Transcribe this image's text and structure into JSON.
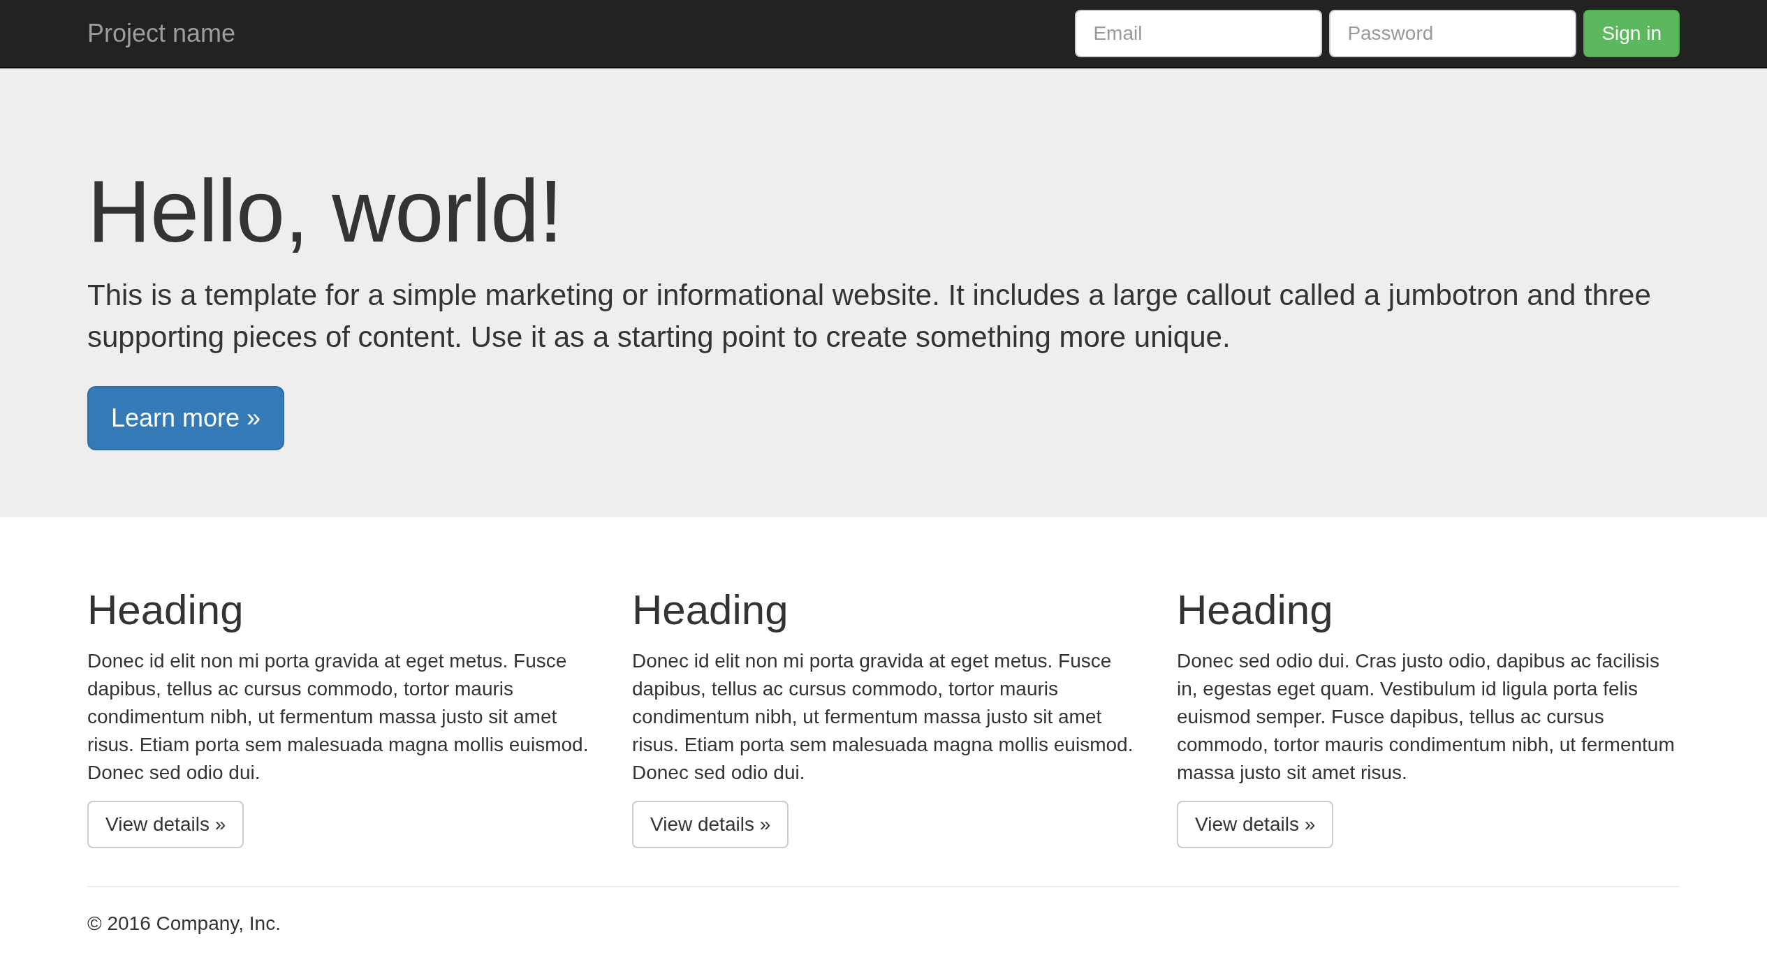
{
  "navbar": {
    "brand": "Project name",
    "email": {
      "placeholder": "Email"
    },
    "password": {
      "placeholder": "Password"
    },
    "sign_in": "Sign in"
  },
  "jumbotron": {
    "title": "Hello, world!",
    "lead": "This is a template for a simple marketing or informational website. It includes a large callout called a jumbotron and three supporting pieces of content. Use it as a starting point to create something more unique.",
    "button": "Learn more »"
  },
  "columns": [
    {
      "heading": "Heading",
      "text": "Donec id elit non mi porta gravida at eget metus. Fusce dapibus, tellus ac cursus commodo, tortor mauris condimentum nibh, ut fermentum massa justo sit amet risus. Etiam porta sem malesuada magna mollis euismod. Donec sed odio dui.",
      "button": "View details »"
    },
    {
      "heading": "Heading",
      "text": "Donec id elit non mi porta gravida at eget metus. Fusce dapibus, tellus ac cursus commodo, tortor mauris condimentum nibh, ut fermentum massa justo sit amet risus. Etiam porta sem malesuada magna mollis euismod. Donec sed odio dui.",
      "button": "View details »"
    },
    {
      "heading": "Heading",
      "text": "Donec sed odio dui. Cras justo odio, dapibus ac facilisis in, egestas eget quam. Vestibulum id ligula porta felis euismod semper. Fusce dapibus, tellus ac cursus commodo, tortor mauris condimentum nibh, ut fermentum massa justo sit amet risus.",
      "button": "View details »"
    }
  ],
  "footer": {
    "text": "© 2016 Company, Inc."
  }
}
